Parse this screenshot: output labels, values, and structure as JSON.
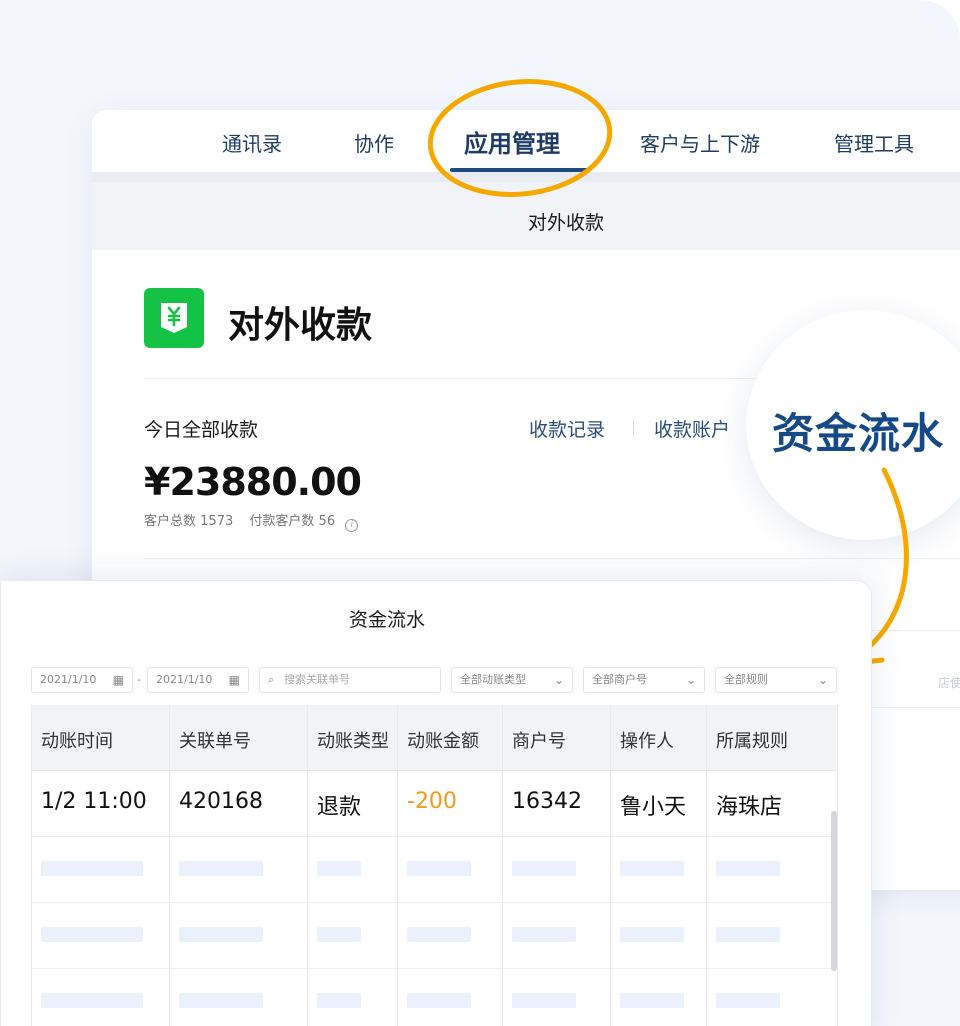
{
  "nav": {
    "items": [
      {
        "label": "通讯录"
      },
      {
        "label": "协作"
      },
      {
        "label": "应用管理",
        "active": true
      },
      {
        "label": "客户与上下游"
      },
      {
        "label": "管理工具"
      }
    ]
  },
  "subheader": {
    "title": "对外收款"
  },
  "app": {
    "title": "对外收款",
    "icon": "yuan-shield-icon"
  },
  "summary": {
    "label": "今日全部收款",
    "amount": "¥23880.00",
    "customers_label": "客户总数",
    "customers_value": "1573",
    "paying_label": "付款客户数",
    "paying_value": "56"
  },
  "links": {
    "records": "收款记录",
    "accounts": "收款账户"
  },
  "bubble": {
    "text": "资金流水"
  },
  "bg_hint": "店使用",
  "flow": {
    "title": "资金流水",
    "filters": {
      "date_from": "2021/1/10",
      "date_sep": "-",
      "date_to": "2021/1/10",
      "search_placeholder": "搜索关联单号",
      "type": "全部动账类型",
      "merchant": "全部商户号",
      "rule": "全部规则"
    },
    "columns": [
      "动账时间",
      "关联单号",
      "动账类型",
      "动账金额",
      "商户号",
      "操作人",
      "所属规则"
    ],
    "rows": [
      {
        "time": "1/2 11:00",
        "order": "420168",
        "type": "退款",
        "amount": "-200",
        "merchant": "16342",
        "operator": "鲁小天",
        "rule": "海珠店"
      }
    ]
  },
  "colors": {
    "accent": "#1e4a80",
    "highlight": "#f5a800",
    "green": "#14c245",
    "negative": "#f29a1a"
  }
}
